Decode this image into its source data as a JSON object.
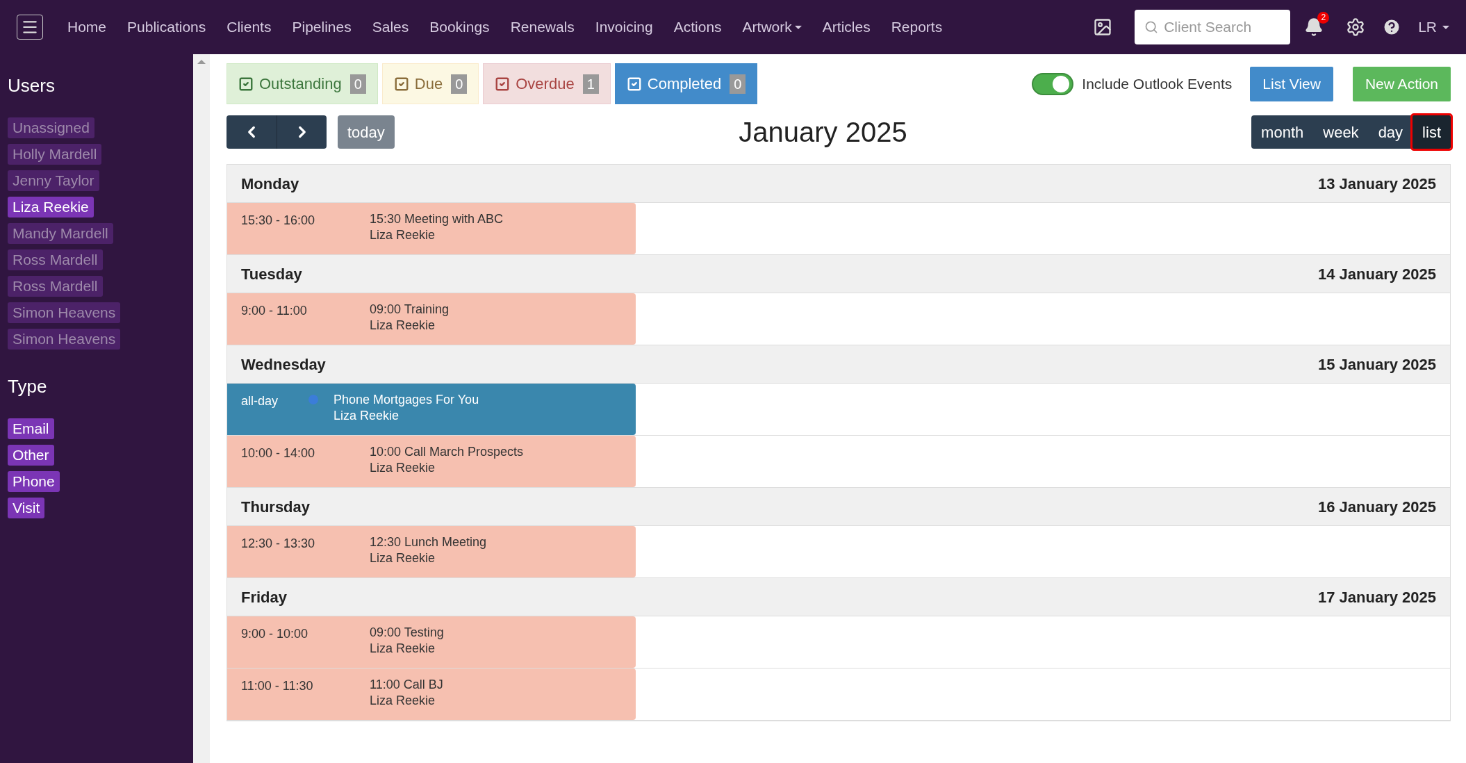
{
  "nav": {
    "items": [
      {
        "label": "Home",
        "dropdown": false
      },
      {
        "label": "Publications",
        "dropdown": false
      },
      {
        "label": "Clients",
        "dropdown": false
      },
      {
        "label": "Pipelines",
        "dropdown": false
      },
      {
        "label": "Sales",
        "dropdown": false
      },
      {
        "label": "Bookings",
        "dropdown": false
      },
      {
        "label": "Renewals",
        "dropdown": false
      },
      {
        "label": "Invoicing",
        "dropdown": false
      },
      {
        "label": "Actions",
        "dropdown": false
      },
      {
        "label": "Artwork",
        "dropdown": true
      },
      {
        "label": "Articles",
        "dropdown": false
      },
      {
        "label": "Reports",
        "dropdown": false
      }
    ],
    "search": {
      "placeholder": "Client Search"
    },
    "notifications": "2",
    "user": "LR"
  },
  "sidebar": {
    "users_title": "Users",
    "users": [
      {
        "label": "Unassigned",
        "selected": false
      },
      {
        "label": "Holly Mardell",
        "selected": false
      },
      {
        "label": "Jenny Taylor",
        "selected": false
      },
      {
        "label": "Liza Reekie",
        "selected": true
      },
      {
        "label": "Mandy Mardell",
        "selected": false
      },
      {
        "label": "Ross Mardell",
        "selected": false
      },
      {
        "label": "Ross Mardell",
        "selected": false
      },
      {
        "label": "Simon Heavens",
        "selected": false
      },
      {
        "label": "Simon Heavens",
        "selected": false
      }
    ],
    "type_title": "Type",
    "types": [
      {
        "label": "Email",
        "selected": true
      },
      {
        "label": "Other",
        "selected": true
      },
      {
        "label": "Phone",
        "selected": true
      },
      {
        "label": "Visit",
        "selected": true
      }
    ]
  },
  "filters": [
    {
      "kind": "outstanding",
      "label": "Outstanding",
      "count": "0",
      "selected": false
    },
    {
      "kind": "due",
      "label": "Due",
      "count": "0",
      "selected": false
    },
    {
      "kind": "overdue",
      "label": "Overdue",
      "count": "1",
      "selected": false
    },
    {
      "kind": "completed",
      "label": "Completed",
      "count": "0",
      "selected": true
    }
  ],
  "outlook_toggle": {
    "label": "Include Outlook Events",
    "on": true
  },
  "buttons": {
    "list_view": "List View",
    "new_action": "New Action",
    "today": "today"
  },
  "calendar_title": "January 2025",
  "views": [
    {
      "label": "month",
      "selected": false
    },
    {
      "label": "week",
      "selected": false
    },
    {
      "label": "day",
      "selected": false
    },
    {
      "label": "list",
      "selected": true
    }
  ],
  "days": [
    {
      "weekday": "Monday",
      "date": "13 January 2025",
      "events": [
        {
          "kind": "timed",
          "time": "15:30 - 16:00",
          "title": "15:30 Meeting with ABC",
          "person": "Liza Reekie",
          "color": "#f6c0b0"
        }
      ]
    },
    {
      "weekday": "Tuesday",
      "date": "14 January 2025",
      "events": [
        {
          "kind": "timed",
          "time": "9:00 - 11:00",
          "title": "09:00 Training",
          "person": "Liza Reekie",
          "color": "#f6c0b0"
        }
      ]
    },
    {
      "weekday": "Wednesday",
      "date": "15 January 2025",
      "events": [
        {
          "kind": "allday",
          "time": "all-day",
          "title": "Phone Mortgages For You",
          "person": "Liza Reekie",
          "color": "#3a87ad"
        },
        {
          "kind": "timed",
          "time": "10:00 - 14:00",
          "title": "10:00 Call March Prospects",
          "person": "Liza Reekie",
          "color": "#f6c0b0"
        }
      ]
    },
    {
      "weekday": "Thursday",
      "date": "16 January 2025",
      "events": [
        {
          "kind": "timed",
          "time": "12:30 - 13:30",
          "title": "12:30 Lunch Meeting",
          "person": "Liza Reekie",
          "color": "#f6c0b0"
        }
      ]
    },
    {
      "weekday": "Friday",
      "date": "17 January 2025",
      "events": [
        {
          "kind": "timed",
          "time": "9:00 - 10:00",
          "title": "09:00 Testing",
          "person": "Liza Reekie",
          "color": "#f6c0b0"
        },
        {
          "kind": "timed",
          "time": "11:00 - 11:30",
          "title": "11:00 Call BJ",
          "person": "Liza Reekie",
          "color": "#f6c0b0"
        }
      ]
    }
  ]
}
